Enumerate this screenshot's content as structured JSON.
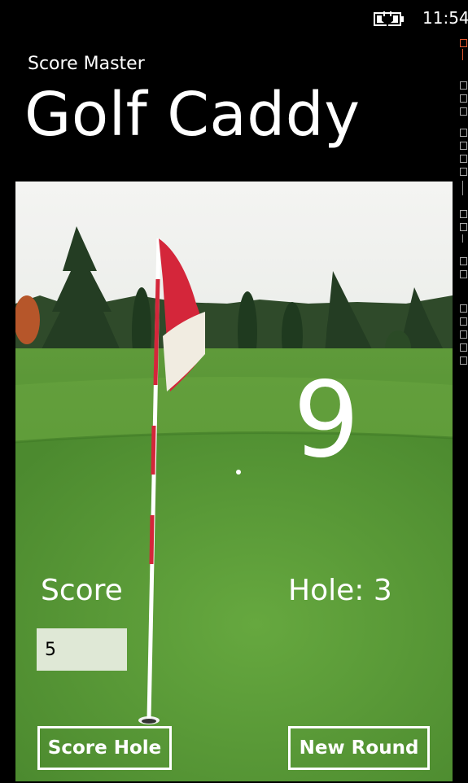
{
  "status_bar": {
    "time": "11:54",
    "battery_icon": "battery-charging-icon"
  },
  "header": {
    "app_name": "Score Master",
    "page_title": "Golf Caddy"
  },
  "main": {
    "par_number": "9",
    "score_label": "Score",
    "hole_label": "Hole: 3",
    "score_input_value": "5",
    "score_hole_button": "Score Hole",
    "new_round_button": "New Round"
  },
  "colors": {
    "background": "#000000",
    "text": "#ffffff",
    "input_bg": "#dfe8d6",
    "flag_red": "#d4263a",
    "grass": "#4e8e31"
  }
}
